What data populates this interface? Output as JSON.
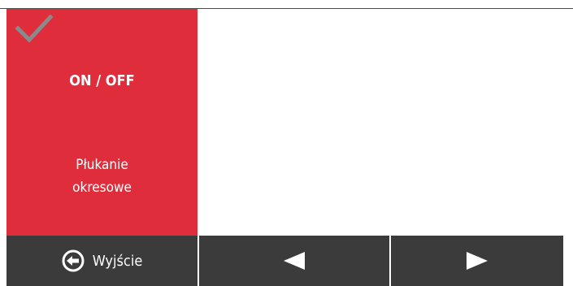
{
  "tile": {
    "status_icon": "checkmark-icon",
    "primary_text": "ON / OFF",
    "label_line1": "Płukanie",
    "label_line2": "okresowe",
    "background_color": "#e02d3c"
  },
  "footer": {
    "exit_label": "Wyjście",
    "exit_icon": "exit-arrow-icon",
    "prev_icon": "triangle-left-icon",
    "next_icon": "triangle-right-icon",
    "button_color": "#3b3b3b"
  }
}
